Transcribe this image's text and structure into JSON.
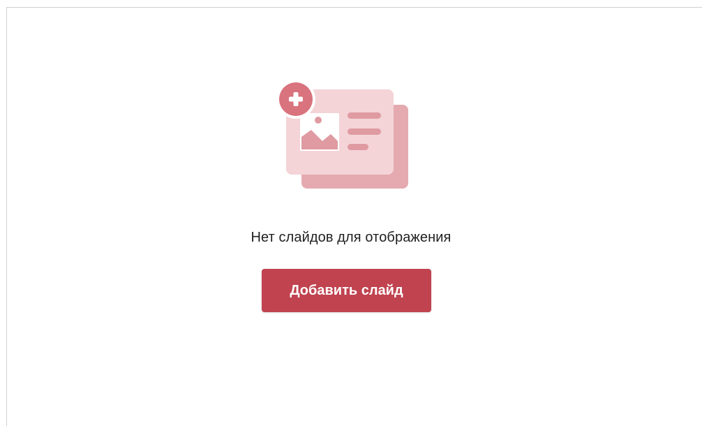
{
  "empty_state": {
    "message": "Нет слайдов для отображения",
    "illustration_icon": "add-slide-illustration-icon"
  },
  "actions": {
    "add_slide_label": "Добавить слайд"
  },
  "colors": {
    "accent": "#c0434f",
    "illustration_back": "#e4aab0",
    "illustration_front": "#f4d4d7",
    "illustration_detail": "#df9aa2",
    "plus_badge": "#d9737e"
  }
}
